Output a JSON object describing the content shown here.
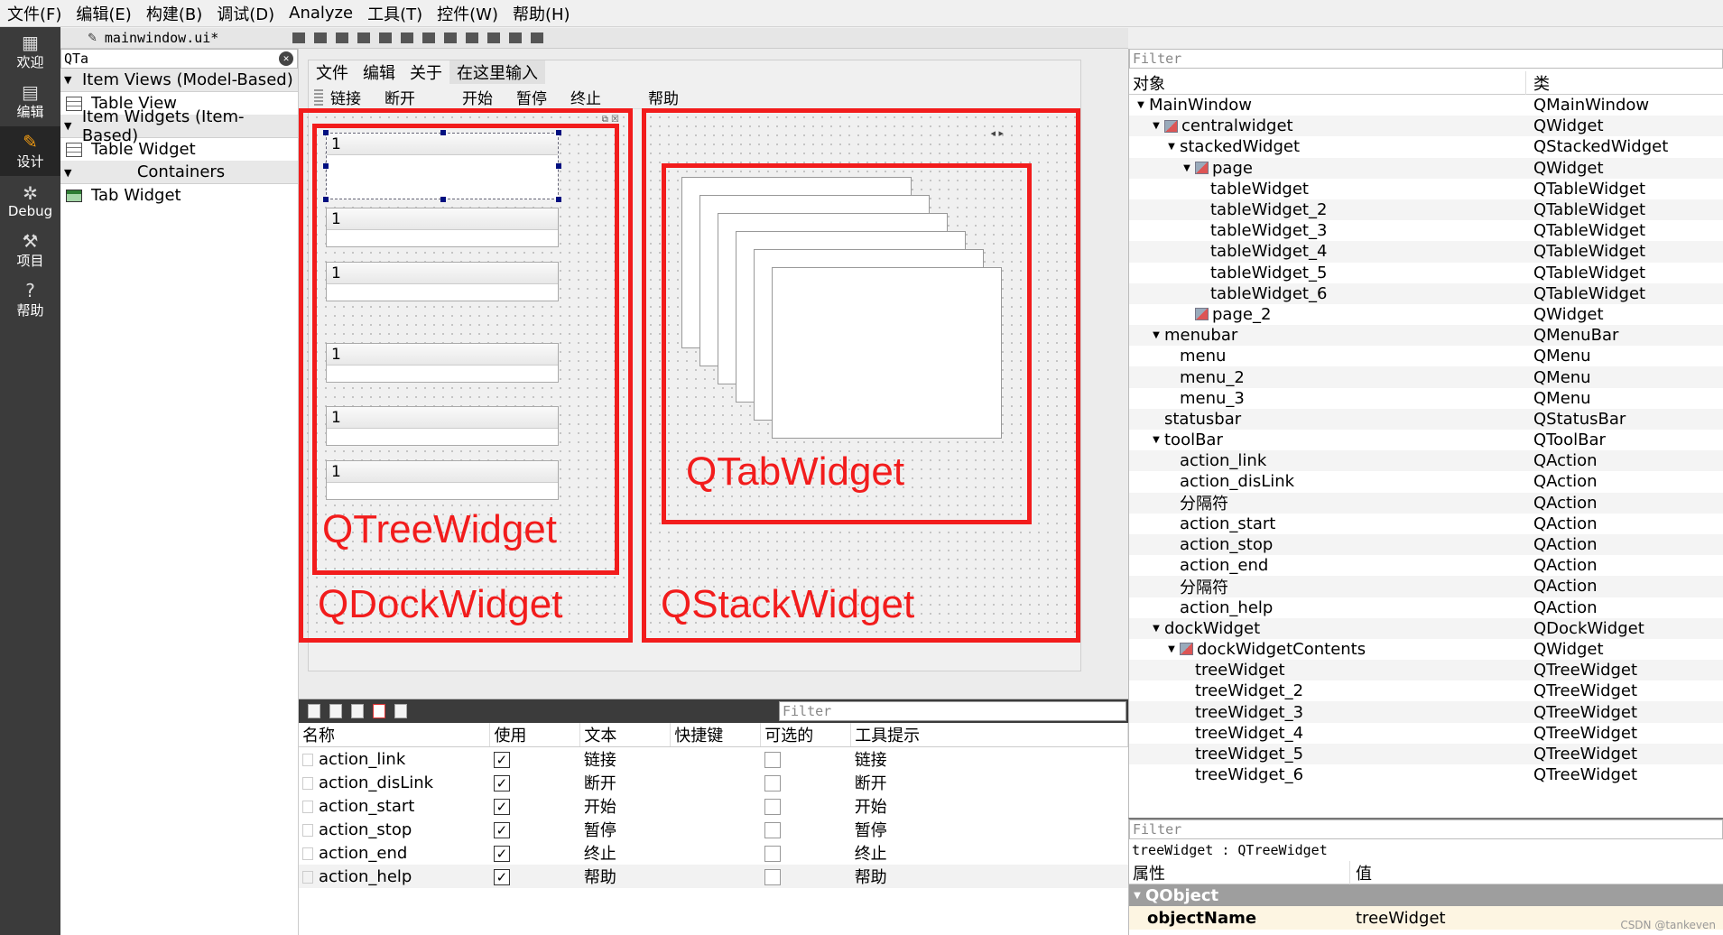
{
  "menubar": [
    "文件(F)",
    "编辑(E)",
    "构建(B)",
    "调试(D)",
    "Analyze",
    "工具(T)",
    "控件(W)",
    "帮助(H)"
  ],
  "modes": [
    {
      "label": "欢迎",
      "icon": "grid-icon"
    },
    {
      "label": "编辑",
      "icon": "document-icon"
    },
    {
      "label": "设计",
      "icon": "pencil-icon"
    },
    {
      "label": "Debug",
      "icon": "bug-icon"
    },
    {
      "label": "项目",
      "icon": "wrench-icon"
    },
    {
      "label": "帮助",
      "icon": "help-icon"
    }
  ],
  "editor": {
    "filename": "mainwindow.ui*"
  },
  "widgetbox": {
    "search": "QTa",
    "cat_item_views": "Item Views (Model-Based)",
    "table_view": "Table View",
    "cat_item_widgets": "Item Widgets (Item-Based)",
    "table_widget": "Table Widget",
    "cat_containers": "Containers",
    "tab_widget": "Tab Widget"
  },
  "form": {
    "menus": [
      "文件",
      "编辑",
      "关于",
      "在这里输入"
    ],
    "toolbar": [
      "链接",
      "断开",
      "开始",
      "暂停",
      "终止",
      "帮助"
    ],
    "tree_header": "1",
    "labels": {
      "tree": "QTreeWidget",
      "dock": "QDockWidget",
      "tab": "QTabWidget",
      "stack": "QStackWidget"
    }
  },
  "action_editor": {
    "filter_placeholder": "Filter",
    "columns": [
      "名称",
      "使用",
      "文本",
      "快捷键",
      "可选的",
      "工具提示"
    ],
    "rows": [
      {
        "name": "action_link",
        "used": "✓",
        "text": "链接",
        "tooltip": "链接"
      },
      {
        "name": "action_disLink",
        "used": "✓",
        "text": "断开",
        "tooltip": "断开"
      },
      {
        "name": "action_start",
        "used": "✓",
        "text": "开始",
        "tooltip": "开始"
      },
      {
        "name": "action_stop",
        "used": "✓",
        "text": "暂停",
        "tooltip": "暂停"
      },
      {
        "name": "action_end",
        "used": "✓",
        "text": "终止",
        "tooltip": "终止"
      },
      {
        "name": "action_help",
        "used": "✓",
        "text": "帮助",
        "tooltip": "帮助"
      }
    ]
  },
  "object_inspector": {
    "filter_placeholder": "Filter",
    "col_object": "对象",
    "col_class": "类",
    "rows": [
      {
        "name": "MainWindow",
        "cls": "QMainWindow",
        "level": 0,
        "arrow": "▼",
        "icon": false
      },
      {
        "name": "centralwidget",
        "cls": "QWidget",
        "level": 1,
        "arrow": "▼",
        "icon": true
      },
      {
        "name": "stackedWidget",
        "cls": "QStackedWidget",
        "level": 2,
        "arrow": "▼",
        "icon": false
      },
      {
        "name": "page",
        "cls": "QWidget",
        "level": 3,
        "arrow": "▼",
        "icon": true
      },
      {
        "name": "tableWidget",
        "cls": "QTableWidget",
        "level": 4,
        "arrow": "",
        "icon": false
      },
      {
        "name": "tableWidget_2",
        "cls": "QTableWidget",
        "level": 4,
        "arrow": "",
        "icon": false
      },
      {
        "name": "tableWidget_3",
        "cls": "QTableWidget",
        "level": 4,
        "arrow": "",
        "icon": false
      },
      {
        "name": "tableWidget_4",
        "cls": "QTableWidget",
        "level": 4,
        "arrow": "",
        "icon": false
      },
      {
        "name": "tableWidget_5",
        "cls": "QTableWidget",
        "level": 4,
        "arrow": "",
        "icon": false
      },
      {
        "name": "tableWidget_6",
        "cls": "QTableWidget",
        "level": 4,
        "arrow": "",
        "icon": false
      },
      {
        "name": "page_2",
        "cls": "QWidget",
        "level": 3,
        "arrow": "",
        "icon": true
      },
      {
        "name": "menubar",
        "cls": "QMenuBar",
        "level": 1,
        "arrow": "▼",
        "icon": false
      },
      {
        "name": "menu",
        "cls": "QMenu",
        "level": 2,
        "arrow": "",
        "icon": false
      },
      {
        "name": "menu_2",
        "cls": "QMenu",
        "level": 2,
        "arrow": "",
        "icon": false
      },
      {
        "name": "menu_3",
        "cls": "QMenu",
        "level": 2,
        "arrow": "",
        "icon": false
      },
      {
        "name": "statusbar",
        "cls": "QStatusBar",
        "level": 1,
        "arrow": "",
        "icon": false
      },
      {
        "name": "toolBar",
        "cls": "QToolBar",
        "level": 1,
        "arrow": "▼",
        "icon": false
      },
      {
        "name": "action_link",
        "cls": "QAction",
        "level": 2,
        "arrow": "",
        "icon": false
      },
      {
        "name": "action_disLink",
        "cls": "QAction",
        "level": 2,
        "arrow": "",
        "icon": false
      },
      {
        "name": "分隔符",
        "cls": "QAction",
        "level": 2,
        "arrow": "",
        "icon": false
      },
      {
        "name": "action_start",
        "cls": "QAction",
        "level": 2,
        "arrow": "",
        "icon": false
      },
      {
        "name": "action_stop",
        "cls": "QAction",
        "level": 2,
        "arrow": "",
        "icon": false
      },
      {
        "name": "action_end",
        "cls": "QAction",
        "level": 2,
        "arrow": "",
        "icon": false
      },
      {
        "name": "分隔符",
        "cls": "QAction",
        "level": 2,
        "arrow": "",
        "icon": false
      },
      {
        "name": "action_help",
        "cls": "QAction",
        "level": 2,
        "arrow": "",
        "icon": false
      },
      {
        "name": "dockWidget",
        "cls": "QDockWidget",
        "level": 1,
        "arrow": "▼",
        "icon": false
      },
      {
        "name": "dockWidgetContents",
        "cls": "QWidget",
        "level": 2,
        "arrow": "▼",
        "icon": true
      },
      {
        "name": "treeWidget",
        "cls": "QTreeWidget",
        "level": 3,
        "arrow": "",
        "icon": false
      },
      {
        "name": "treeWidget_2",
        "cls": "QTreeWidget",
        "level": 3,
        "arrow": "",
        "icon": false
      },
      {
        "name": "treeWidget_3",
        "cls": "QTreeWidget",
        "level": 3,
        "arrow": "",
        "icon": false
      },
      {
        "name": "treeWidget_4",
        "cls": "QTreeWidget",
        "level": 3,
        "arrow": "",
        "icon": false
      },
      {
        "name": "treeWidget_5",
        "cls": "QTreeWidget",
        "level": 3,
        "arrow": "",
        "icon": false
      },
      {
        "name": "treeWidget_6",
        "cls": "QTreeWidget",
        "level": 3,
        "arrow": "",
        "icon": false
      }
    ]
  },
  "property_editor": {
    "filter_placeholder": "Filter",
    "object": "treeWidget : QTreeWidget",
    "col_property": "属性",
    "col_value": "值",
    "section": "QObject",
    "prop_name": "objectName",
    "prop_value": "treeWidget"
  },
  "watermark": "CSDN @tankeven",
  "colors": {
    "annotation_red": "#f21c1c",
    "mode_bar": "#3b3b3b",
    "design_icon": "#f39c12"
  }
}
